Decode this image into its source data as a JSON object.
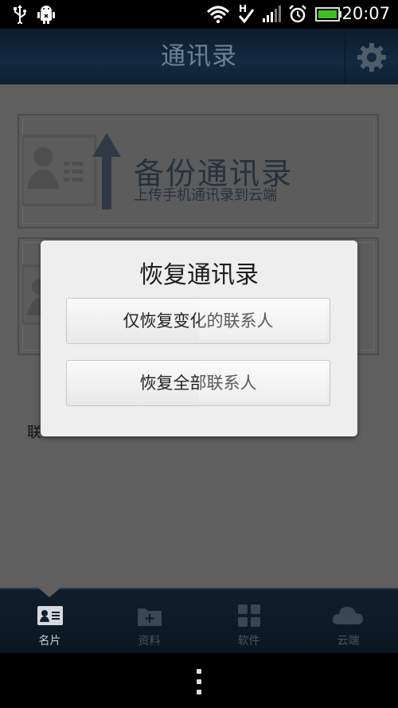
{
  "status_bar": {
    "time": "20:07",
    "icons": [
      "usb-icon",
      "android-debug-icon",
      "wifi-icon",
      "hspa-data-icon",
      "signal-icon",
      "alarm-icon",
      "battery-icon"
    ],
    "network_type": "H"
  },
  "header": {
    "title": "通讯录",
    "settings_icon": "gear-icon"
  },
  "cards": [
    {
      "title": "备份通讯录",
      "subtitle": "上传手机通讯录到云端",
      "icon": "upload-contacts-icon"
    },
    {
      "icon": "download-contacts-icon"
    }
  ],
  "partial_text": "联",
  "dialog": {
    "title": "恢复通讯录",
    "buttons": [
      "仅恢复变化的联系人",
      "恢复全部联系人"
    ]
  },
  "bottom_nav": {
    "items": [
      {
        "label": "名片",
        "icon": "contact-card-icon",
        "active": true
      },
      {
        "label": "资料",
        "icon": "folder-add-icon",
        "active": false
      },
      {
        "label": "软件",
        "icon": "apps-grid-icon",
        "active": false
      },
      {
        "label": "云端",
        "icon": "cloud-icon",
        "active": false
      }
    ]
  },
  "colors": {
    "overlay_content": "#5f5f5f",
    "dialog_bg": "#eeeeee",
    "title_bar": "#132a40",
    "battery": "#3fbf1f"
  }
}
